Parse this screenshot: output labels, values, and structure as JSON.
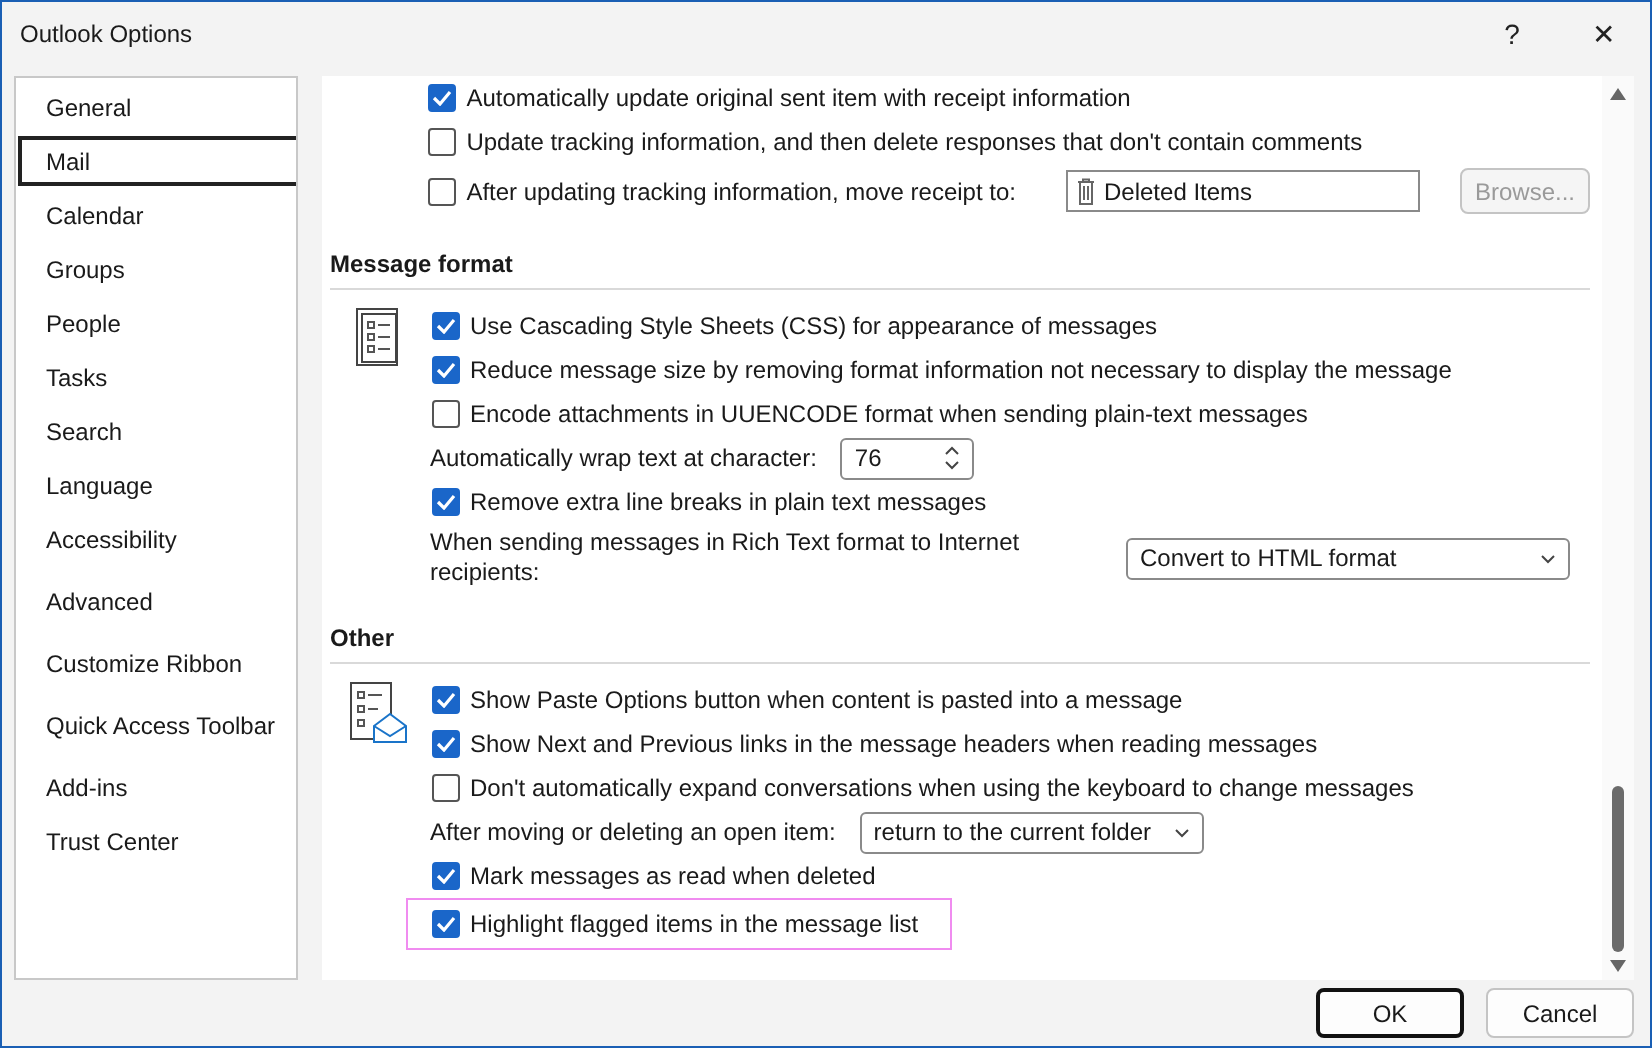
{
  "window": {
    "title": "Outlook Options",
    "help": "?",
    "close": "✕"
  },
  "sidebar": {
    "items": [
      {
        "label": "General",
        "selected": false
      },
      {
        "label": "Mail",
        "selected": true
      },
      {
        "label": "Calendar",
        "selected": false
      },
      {
        "label": "Groups",
        "selected": false
      },
      {
        "label": "People",
        "selected": false
      },
      {
        "label": "Tasks",
        "selected": false
      },
      {
        "label": "Search",
        "selected": false
      },
      {
        "label": "Language",
        "selected": false
      },
      {
        "label": "Accessibility",
        "selected": false
      },
      {
        "label": "Advanced",
        "selected": false
      },
      {
        "label": "Customize Ribbon",
        "selected": false
      },
      {
        "label": "Quick Access Toolbar",
        "selected": false
      },
      {
        "label": "Add-ins",
        "selected": false
      },
      {
        "label": "Trust Center",
        "selected": false
      }
    ]
  },
  "sections": [
    {
      "rows": [
        {
          "kind": "check",
          "label": "Automatically update original sent item with receipt information",
          "checked": true,
          "highlighted": false
        },
        {
          "kind": "check",
          "label": "Update tracking information, and then delete responses that don't contain comments",
          "checked": false,
          "highlighted": false
        },
        {
          "kind": "move",
          "label": "After updating tracking information, move receipt to:",
          "checked": false,
          "value": "Deleted Items",
          "button": "Browse...",
          "button_disabled": true
        }
      ]
    },
    {
      "title": "Message format",
      "rows": [
        {
          "kind": "check",
          "label": "Use Cascading Style Sheets (CSS) for appearance of messages",
          "checked": true,
          "highlighted": false
        },
        {
          "kind": "check",
          "label": "Reduce message size by removing format information not necessary to display the message",
          "checked": true,
          "highlighted": false
        },
        {
          "kind": "check",
          "label": "Encode attachments in UUENCODE format when sending plain-text messages",
          "checked": false,
          "highlighted": false
        },
        {
          "kind": "spin",
          "label": "Automatically wrap text at character:",
          "value": "76"
        },
        {
          "kind": "check",
          "label": "Remove extra line breaks in plain text messages",
          "checked": true,
          "highlighted": false
        },
        {
          "kind": "select",
          "label": "When sending messages in Rich Text format to Internet recipients:",
          "value": "Convert to HTML format",
          "wide": true
        }
      ]
    },
    {
      "title": "Other",
      "rows": [
        {
          "kind": "check",
          "label": "Show Paste Options button when content is pasted into a message",
          "checked": true,
          "highlighted": false
        },
        {
          "kind": "check",
          "label": "Show Next and Previous links in the message headers when reading messages",
          "checked": true,
          "highlighted": false
        },
        {
          "kind": "check",
          "label": "Don't automatically expand conversations when using the keyboard to change messages",
          "checked": false,
          "highlighted": false
        },
        {
          "kind": "select",
          "label": "After moving or deleting an open item:",
          "value": "return to the current folder",
          "wide": false
        },
        {
          "kind": "check",
          "label": "Mark messages as read when deleted",
          "checked": true,
          "highlighted": false
        },
        {
          "kind": "check",
          "label": "Highlight flagged items in the message list",
          "checked": true,
          "highlighted": true
        }
      ]
    }
  ],
  "buttons": [
    {
      "label": "OK",
      "default": true
    },
    {
      "label": "Cancel",
      "default": false
    }
  ]
}
